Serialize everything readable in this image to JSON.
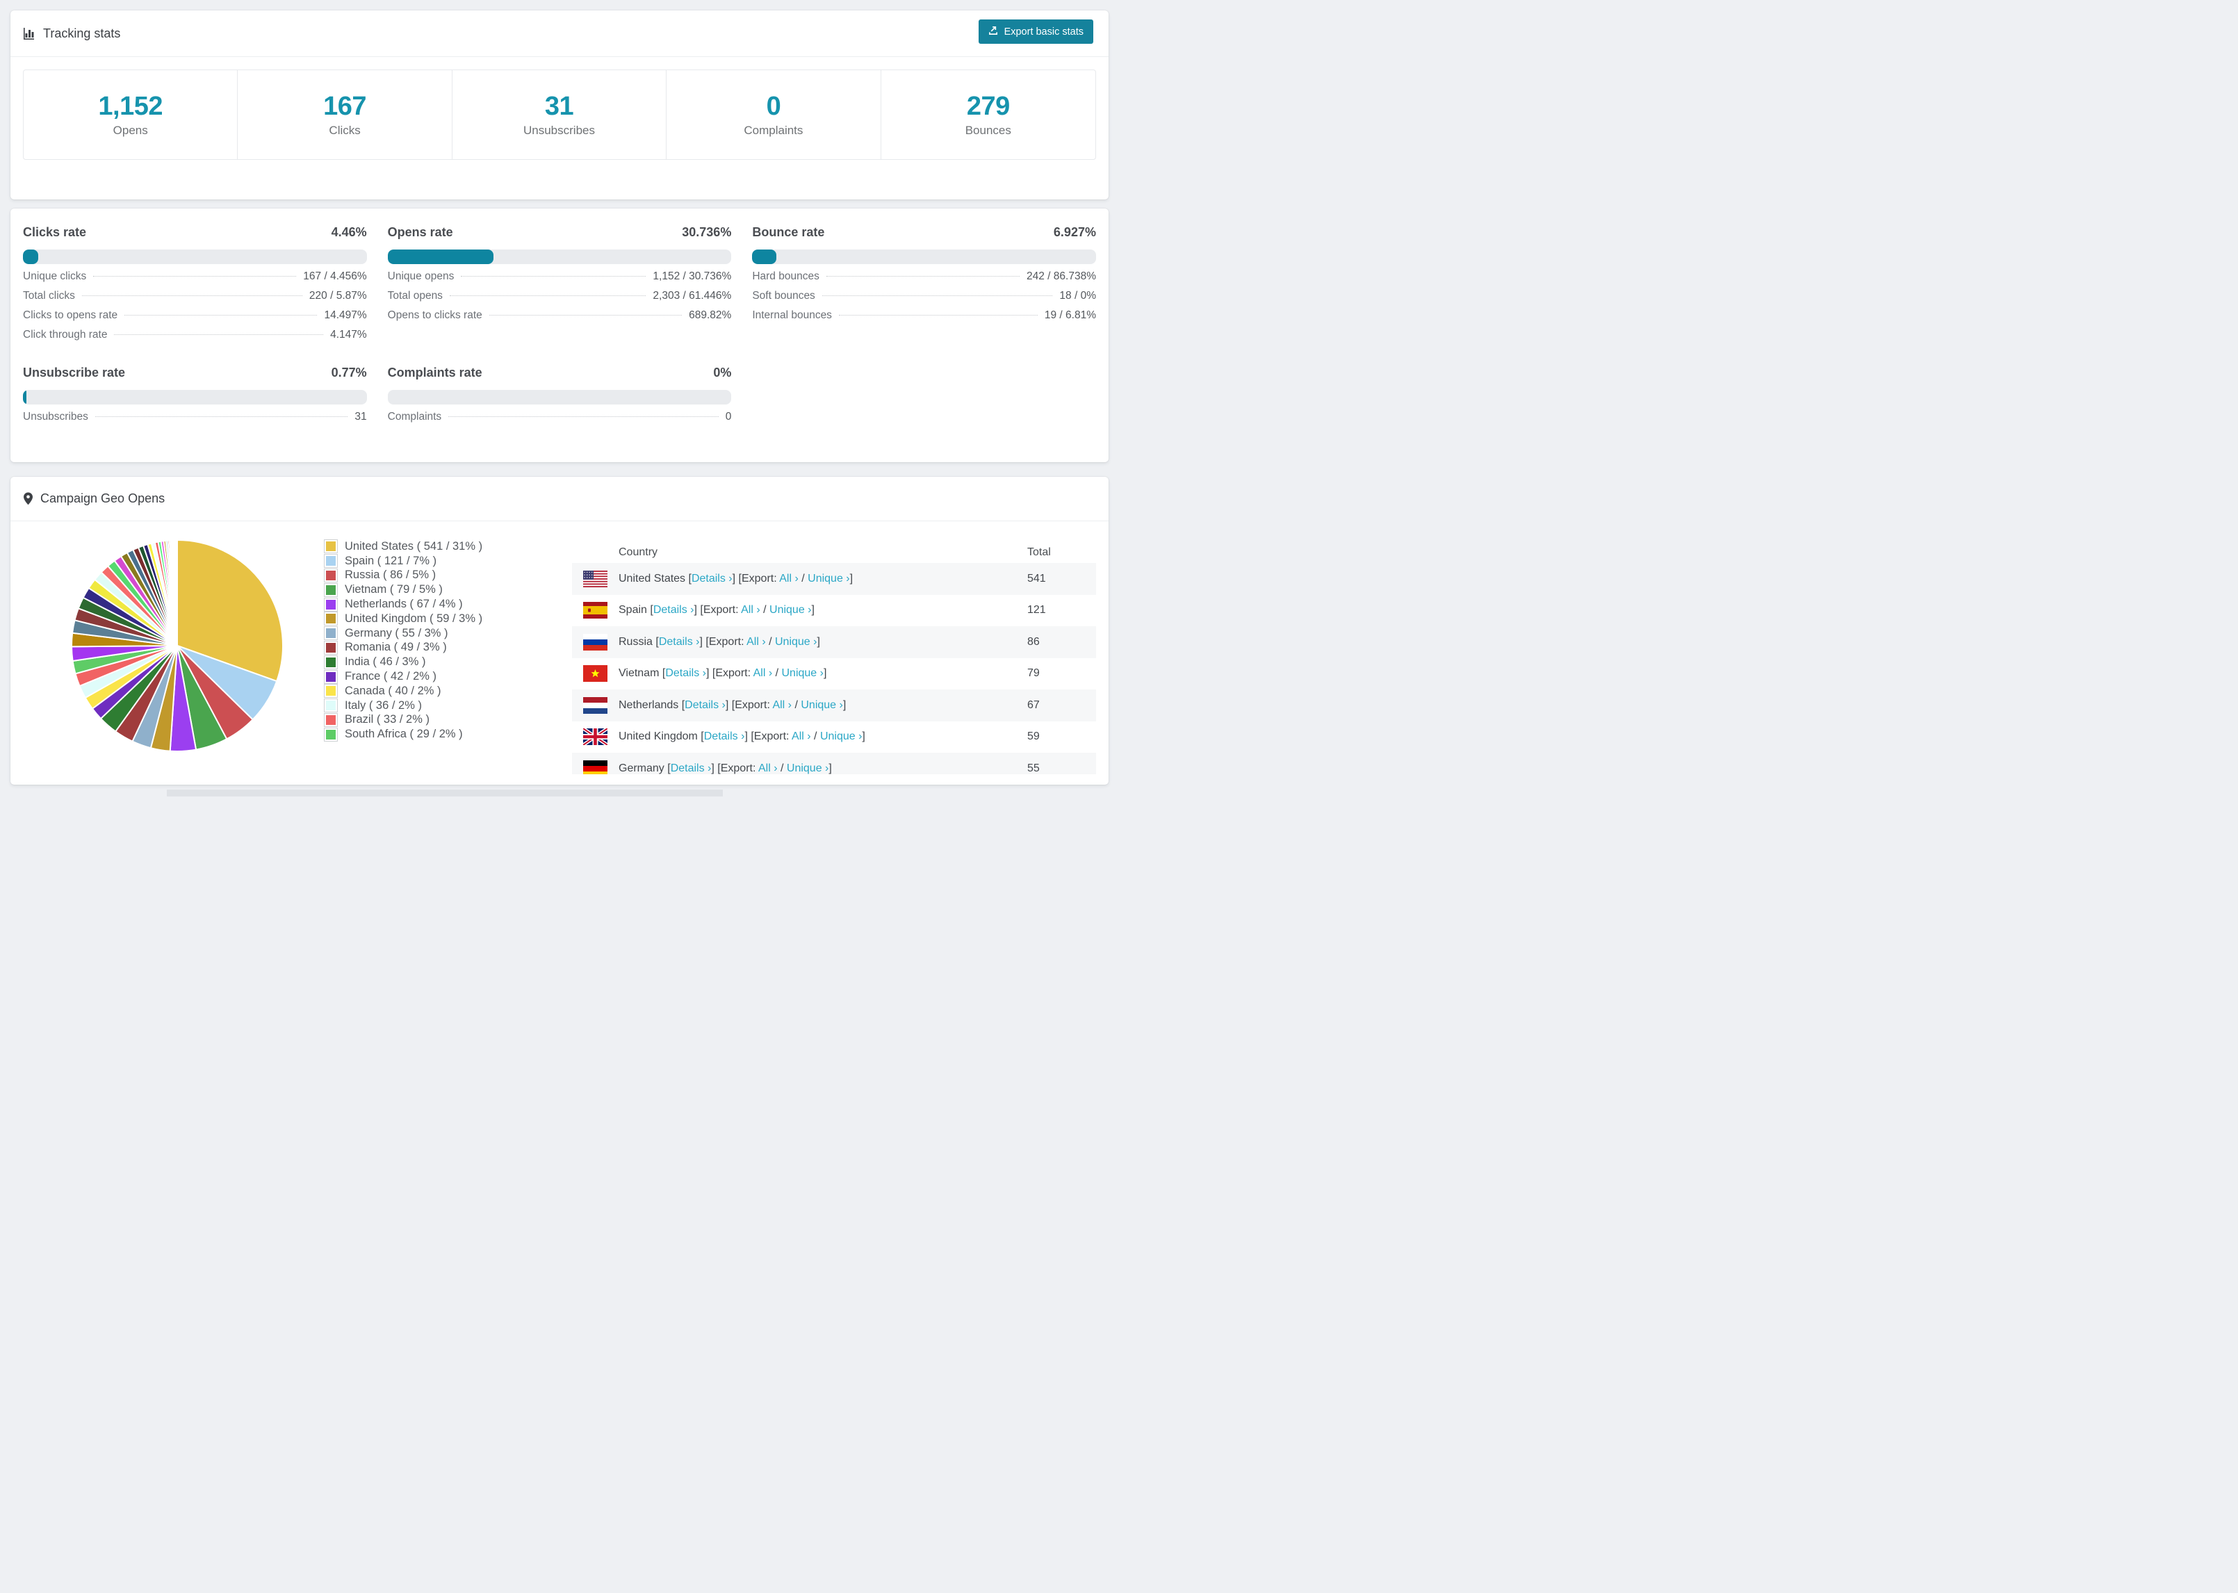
{
  "colors": {
    "accent": "#1693ad",
    "button_bg": "#15829c",
    "link": "#2ba7c6",
    "track": "#e9ebee",
    "fill": "#0e85a0",
    "stripe": "#f6f7f8"
  },
  "tracking_card": {
    "title": "Tracking stats",
    "export_button_label": "Export basic stats",
    "summary": [
      {
        "value": "1,152",
        "label": "Opens"
      },
      {
        "value": "167",
        "label": "Clicks"
      },
      {
        "value": "31",
        "label": "Unsubscribes"
      },
      {
        "value": "0",
        "label": "Complaints"
      },
      {
        "value": "279",
        "label": "Bounces"
      }
    ]
  },
  "rate_blocks": [
    {
      "title": "Clicks rate",
      "value_label": "4.46%",
      "percent": 4.46,
      "rows": [
        {
          "label": "Unique clicks",
          "value": "167 / 4.456%"
        },
        {
          "label": "Total clicks",
          "value": "220 / 5.87%"
        },
        {
          "label": "Clicks to opens rate",
          "value": "14.497%"
        },
        {
          "label": "Click through rate",
          "value": "4.147%"
        }
      ]
    },
    {
      "title": "Opens rate",
      "value_label": "30.736%",
      "percent": 30.736,
      "rows": [
        {
          "label": "Unique opens",
          "value": "1,152 / 30.736%"
        },
        {
          "label": "Total opens",
          "value": "2,303 / 61.446%"
        },
        {
          "label": "Opens to clicks rate",
          "value": "689.82%"
        }
      ]
    },
    {
      "title": "Bounce rate",
      "value_label": "6.927%",
      "percent": 6.927,
      "rows": [
        {
          "label": "Hard bounces",
          "value": "242 / 86.738%"
        },
        {
          "label": "Soft bounces",
          "value": "18 / 0%"
        },
        {
          "label": "Internal bounces",
          "value": "19 / 6.81%"
        }
      ]
    },
    {
      "title": "Unsubscribe rate",
      "value_label": "0.77%",
      "percent": 0.77,
      "rows": [
        {
          "label": "Unsubscribes",
          "value": "31"
        }
      ]
    },
    {
      "title": "Complaints rate",
      "value_label": "0%",
      "percent": 0,
      "rows": [
        {
          "label": "Complaints",
          "value": "0"
        }
      ]
    }
  ],
  "geo_card": {
    "title": "Campaign Geo Opens",
    "links": {
      "details": "Details ›",
      "export": "Export:",
      "all": "All ›",
      "unique": "Unique ›"
    },
    "table_headers": [
      "Country",
      "Total"
    ],
    "table_visible_rows": 7,
    "chart_data": {
      "type": "pie",
      "title": "Campaign Geo Opens",
      "legend_position": "right",
      "start_angle_deg": -90,
      "direction": "clockwise",
      "series": [
        {
          "name": "United States",
          "count": 541,
          "percent": 31,
          "color": "#e7c244",
          "flag": "us"
        },
        {
          "name": "Spain",
          "count": 121,
          "percent": 7,
          "color": "#a9d2f1",
          "flag": "es"
        },
        {
          "name": "Russia",
          "count": 86,
          "percent": 5,
          "color": "#cc4f52",
          "flag": "ru"
        },
        {
          "name": "Vietnam",
          "count": 79,
          "percent": 5,
          "color": "#4aa54e",
          "flag": "vn"
        },
        {
          "name": "Netherlands",
          "count": 67,
          "percent": 4,
          "color": "#9b3ff0",
          "flag": "nl"
        },
        {
          "name": "United Kingdom",
          "count": 59,
          "percent": 3,
          "color": "#c1992b",
          "flag": "gb"
        },
        {
          "name": "Germany",
          "count": 55,
          "percent": 3,
          "color": "#8fb0cb",
          "flag": "de"
        },
        {
          "name": "Romania",
          "count": 49,
          "percent": 3,
          "color": "#a03c3c",
          "flag": "ro"
        },
        {
          "name": "India",
          "count": 46,
          "percent": 3,
          "color": "#2e7d32",
          "flag": "in"
        },
        {
          "name": "France",
          "count": 42,
          "percent": 2,
          "color": "#6f2dc0",
          "flag": "fr"
        },
        {
          "name": "Canada",
          "count": 40,
          "percent": 2,
          "color": "#fae44a",
          "flag": "ca"
        },
        {
          "name": "Italy",
          "count": 36,
          "percent": 2,
          "color": "#dffcfa",
          "flag": "it"
        },
        {
          "name": "Brazil",
          "count": 33,
          "percent": 2,
          "color": "#f16363",
          "flag": "br"
        },
        {
          "name": "South Africa",
          "count": 29,
          "percent": 2,
          "color": "#5ecc66",
          "flag": "za"
        }
      ],
      "other_slices": [
        {
          "percent": 2.2,
          "color": "#a435f0"
        },
        {
          "percent": 2.1,
          "color": "#b8860b"
        },
        {
          "percent": 2.0,
          "color": "#5b7f95"
        },
        {
          "percent": 1.9,
          "color": "#8b3a3a"
        },
        {
          "percent": 1.8,
          "color": "#2d6a30"
        },
        {
          "percent": 1.7,
          "color": "#332a85"
        },
        {
          "percent": 1.6,
          "color": "#f0e93f"
        },
        {
          "percent": 1.5,
          "color": "#dffbf6"
        },
        {
          "percent": 1.4,
          "color": "#f56b6b"
        },
        {
          "percent": 1.3,
          "color": "#56d96f"
        },
        {
          "percent": 1.2,
          "color": "#d44bd0"
        },
        {
          "percent": 1.1,
          "color": "#8a7a1f"
        },
        {
          "percent": 1.0,
          "color": "#49708d"
        },
        {
          "percent": 0.9,
          "color": "#7a2e2e"
        },
        {
          "percent": 0.8,
          "color": "#1e5631"
        },
        {
          "percent": 0.7,
          "color": "#2b2370"
        },
        {
          "percent": 0.6,
          "color": "#f7ef3c"
        },
        {
          "percent": 0.55,
          "color": "#eefffe"
        },
        {
          "percent": 0.5,
          "color": "#f25c5c"
        },
        {
          "percent": 0.45,
          "color": "#4ef07a"
        },
        {
          "percent": 0.4,
          "color": "#e44fe0"
        },
        {
          "percent": 0.35,
          "color": "#caa53d"
        },
        {
          "percent": 0.3,
          "color": "#a8d3f0"
        },
        {
          "percent": 0.25,
          "color": "#e05252"
        },
        {
          "percent": 0.22,
          "color": "#3da23d"
        },
        {
          "percent": 0.2,
          "color": "#8b5cf6"
        },
        {
          "percent": 0.18,
          "color": "#d4af37"
        },
        {
          "percent": 0.15,
          "color": "#9ad6f5"
        },
        {
          "percent": 0.12,
          "color": "#f06666"
        },
        {
          "percent": 0.1,
          "color": "#66e066"
        },
        {
          "percent": 0.08,
          "color": "#c94fe0"
        },
        {
          "percent": 0.06,
          "color": "#d2b62f"
        },
        {
          "percent": 0.05,
          "color": "#7fb8e8"
        },
        {
          "percent": 0.04,
          "color": "#e86a6a"
        }
      ]
    }
  }
}
